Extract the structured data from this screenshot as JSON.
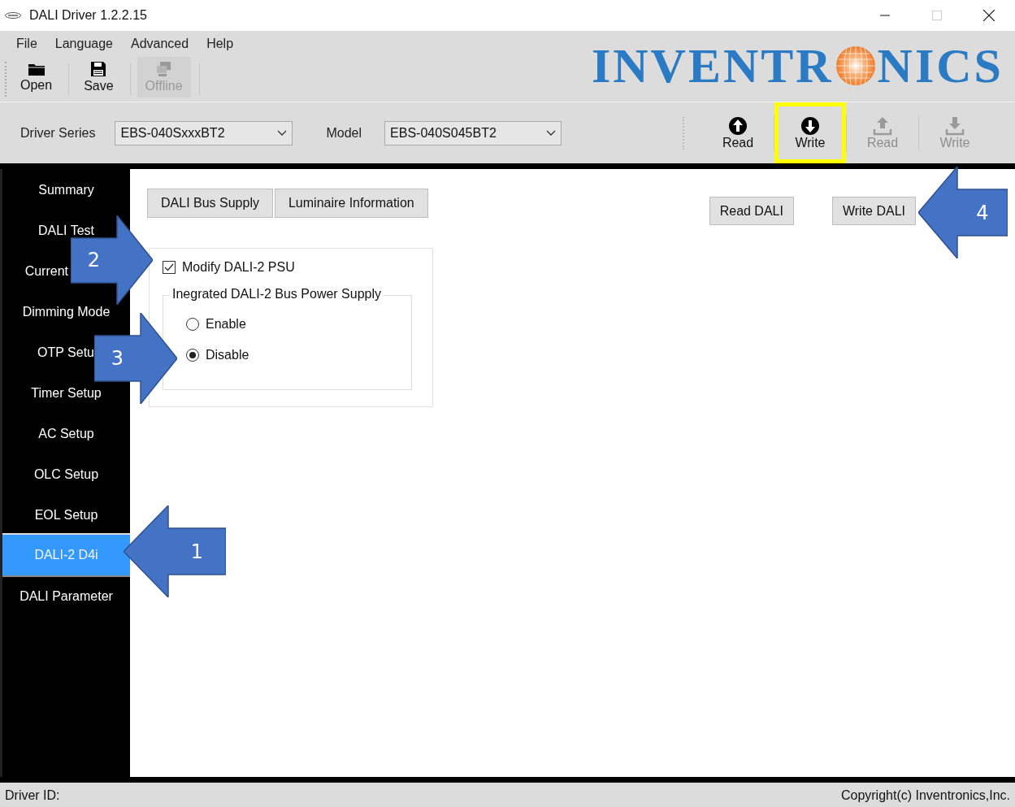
{
  "window": {
    "title": "DALI Driver  1.2.2.15"
  },
  "menu": [
    "File",
    "Language",
    "Advanced",
    "Help"
  ],
  "toolbar": [
    {
      "label": "Open",
      "disabled": false
    },
    {
      "label": "Save",
      "disabled": false
    },
    {
      "label": "Offline",
      "disabled": true
    }
  ],
  "logo": {
    "text_before": "INVENTR",
    "text_after": "NICS"
  },
  "driver_series": {
    "label": "Driver Series",
    "value": "EBS-040SxxxBT2"
  },
  "model": {
    "label": "Model",
    "value": "EBS-040S045BT2"
  },
  "device_buttons": [
    {
      "label": "Read",
      "disabled": false,
      "highlighted": false
    },
    {
      "label": "Write",
      "disabled": false,
      "highlighted": true
    },
    {
      "label": "Read",
      "disabled": true,
      "highlighted": false
    },
    {
      "label": "Write",
      "disabled": true,
      "highlighted": false
    }
  ],
  "sidebar": {
    "items": [
      {
        "label": "Summary",
        "selected": false
      },
      {
        "label": "DALI Test",
        "selected": false
      },
      {
        "label": "Current",
        "selected": false
      },
      {
        "label": "Dimming Mode",
        "selected": false
      },
      {
        "label": "OTP Setu",
        "selected": false
      },
      {
        "label": "Timer Setup",
        "selected": false
      },
      {
        "label": "AC Setup",
        "selected": false
      },
      {
        "label": "OLC Setup",
        "selected": false
      },
      {
        "label": "EOL Setup",
        "selected": false
      },
      {
        "label": "DALI-2 D4i",
        "selected": true
      },
      {
        "label": "DALI Parameter",
        "selected": false
      }
    ]
  },
  "subtabs": [
    "DALI Bus Supply",
    "Luminaire Information"
  ],
  "actions": [
    "Read DALI",
    "Write DALI"
  ],
  "modify_checkbox": {
    "label": "Modify DALI-2 PSU",
    "checked": true
  },
  "power_supply_group": {
    "title": "Inegrated DALI-2 Bus Power Supply",
    "options": [
      {
        "label": "Enable",
        "selected": false
      },
      {
        "label": "Disable",
        "selected": true
      }
    ]
  },
  "callouts": [
    {
      "number": "1",
      "kind": "left"
    },
    {
      "number": "2",
      "kind": "right"
    },
    {
      "number": "3",
      "kind": "right"
    },
    {
      "number": "4",
      "kind": "left"
    }
  ],
  "status_bar": {
    "left": "Driver ID:",
    "right": "Copyright(c) Inventronics,Inc."
  }
}
